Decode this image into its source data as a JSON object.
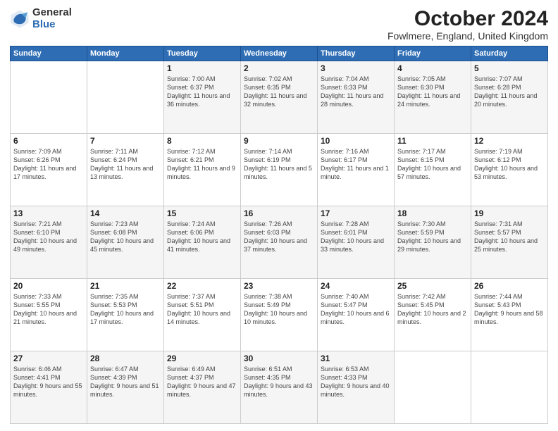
{
  "logo": {
    "general": "General",
    "blue": "Blue"
  },
  "header": {
    "month": "October 2024",
    "location": "Fowlmere, England, United Kingdom"
  },
  "days_of_week": [
    "Sunday",
    "Monday",
    "Tuesday",
    "Wednesday",
    "Thursday",
    "Friday",
    "Saturday"
  ],
  "weeks": [
    [
      {
        "day": "",
        "info": ""
      },
      {
        "day": "",
        "info": ""
      },
      {
        "day": "1",
        "info": "Sunrise: 7:00 AM\nSunset: 6:37 PM\nDaylight: 11 hours and 36 minutes."
      },
      {
        "day": "2",
        "info": "Sunrise: 7:02 AM\nSunset: 6:35 PM\nDaylight: 11 hours and 32 minutes."
      },
      {
        "day": "3",
        "info": "Sunrise: 7:04 AM\nSunset: 6:33 PM\nDaylight: 11 hours and 28 minutes."
      },
      {
        "day": "4",
        "info": "Sunrise: 7:05 AM\nSunset: 6:30 PM\nDaylight: 11 hours and 24 minutes."
      },
      {
        "day": "5",
        "info": "Sunrise: 7:07 AM\nSunset: 6:28 PM\nDaylight: 11 hours and 20 minutes."
      }
    ],
    [
      {
        "day": "6",
        "info": "Sunrise: 7:09 AM\nSunset: 6:26 PM\nDaylight: 11 hours and 17 minutes."
      },
      {
        "day": "7",
        "info": "Sunrise: 7:11 AM\nSunset: 6:24 PM\nDaylight: 11 hours and 13 minutes."
      },
      {
        "day": "8",
        "info": "Sunrise: 7:12 AM\nSunset: 6:21 PM\nDaylight: 11 hours and 9 minutes."
      },
      {
        "day": "9",
        "info": "Sunrise: 7:14 AM\nSunset: 6:19 PM\nDaylight: 11 hours and 5 minutes."
      },
      {
        "day": "10",
        "info": "Sunrise: 7:16 AM\nSunset: 6:17 PM\nDaylight: 11 hours and 1 minute."
      },
      {
        "day": "11",
        "info": "Sunrise: 7:17 AM\nSunset: 6:15 PM\nDaylight: 10 hours and 57 minutes."
      },
      {
        "day": "12",
        "info": "Sunrise: 7:19 AM\nSunset: 6:12 PM\nDaylight: 10 hours and 53 minutes."
      }
    ],
    [
      {
        "day": "13",
        "info": "Sunrise: 7:21 AM\nSunset: 6:10 PM\nDaylight: 10 hours and 49 minutes."
      },
      {
        "day": "14",
        "info": "Sunrise: 7:23 AM\nSunset: 6:08 PM\nDaylight: 10 hours and 45 minutes."
      },
      {
        "day": "15",
        "info": "Sunrise: 7:24 AM\nSunset: 6:06 PM\nDaylight: 10 hours and 41 minutes."
      },
      {
        "day": "16",
        "info": "Sunrise: 7:26 AM\nSunset: 6:03 PM\nDaylight: 10 hours and 37 minutes."
      },
      {
        "day": "17",
        "info": "Sunrise: 7:28 AM\nSunset: 6:01 PM\nDaylight: 10 hours and 33 minutes."
      },
      {
        "day": "18",
        "info": "Sunrise: 7:30 AM\nSunset: 5:59 PM\nDaylight: 10 hours and 29 minutes."
      },
      {
        "day": "19",
        "info": "Sunrise: 7:31 AM\nSunset: 5:57 PM\nDaylight: 10 hours and 25 minutes."
      }
    ],
    [
      {
        "day": "20",
        "info": "Sunrise: 7:33 AM\nSunset: 5:55 PM\nDaylight: 10 hours and 21 minutes."
      },
      {
        "day": "21",
        "info": "Sunrise: 7:35 AM\nSunset: 5:53 PM\nDaylight: 10 hours and 17 minutes."
      },
      {
        "day": "22",
        "info": "Sunrise: 7:37 AM\nSunset: 5:51 PM\nDaylight: 10 hours and 14 minutes."
      },
      {
        "day": "23",
        "info": "Sunrise: 7:38 AM\nSunset: 5:49 PM\nDaylight: 10 hours and 10 minutes."
      },
      {
        "day": "24",
        "info": "Sunrise: 7:40 AM\nSunset: 5:47 PM\nDaylight: 10 hours and 6 minutes."
      },
      {
        "day": "25",
        "info": "Sunrise: 7:42 AM\nSunset: 5:45 PM\nDaylight: 10 hours and 2 minutes."
      },
      {
        "day": "26",
        "info": "Sunrise: 7:44 AM\nSunset: 5:43 PM\nDaylight: 9 hours and 58 minutes."
      }
    ],
    [
      {
        "day": "27",
        "info": "Sunrise: 6:46 AM\nSunset: 4:41 PM\nDaylight: 9 hours and 55 minutes."
      },
      {
        "day": "28",
        "info": "Sunrise: 6:47 AM\nSunset: 4:39 PM\nDaylight: 9 hours and 51 minutes."
      },
      {
        "day": "29",
        "info": "Sunrise: 6:49 AM\nSunset: 4:37 PM\nDaylight: 9 hours and 47 minutes."
      },
      {
        "day": "30",
        "info": "Sunrise: 6:51 AM\nSunset: 4:35 PM\nDaylight: 9 hours and 43 minutes."
      },
      {
        "day": "31",
        "info": "Sunrise: 6:53 AM\nSunset: 4:33 PM\nDaylight: 9 hours and 40 minutes."
      },
      {
        "day": "",
        "info": ""
      },
      {
        "day": "",
        "info": ""
      }
    ]
  ]
}
